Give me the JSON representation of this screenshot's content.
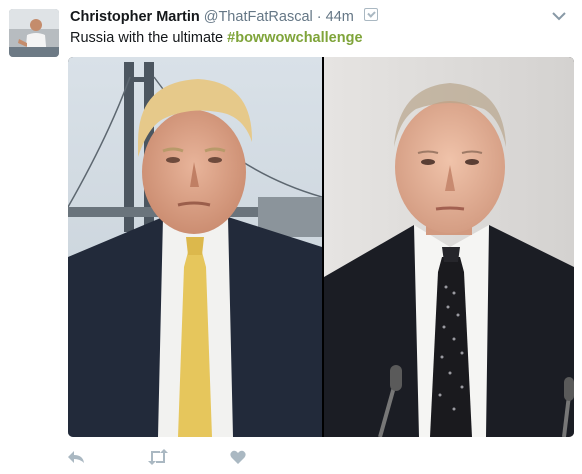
{
  "tweet": {
    "display_name": "Christopher Martin",
    "handle": "@ThatFatRascal",
    "separator": "·",
    "time": "44m",
    "text": "Russia with the ultimate",
    "hashtag": "#bowwowchallenge"
  },
  "icons": {
    "avatar": "user-avatar",
    "verified": "notification-box-icon",
    "menu": "chevron-down-icon",
    "reply": "reply-icon",
    "retweet": "retweet-icon",
    "like": "heart-icon"
  },
  "colors": {
    "hashtag": "#7fa43a",
    "muted": "#657786",
    "action_icon": "#aab8c2"
  }
}
